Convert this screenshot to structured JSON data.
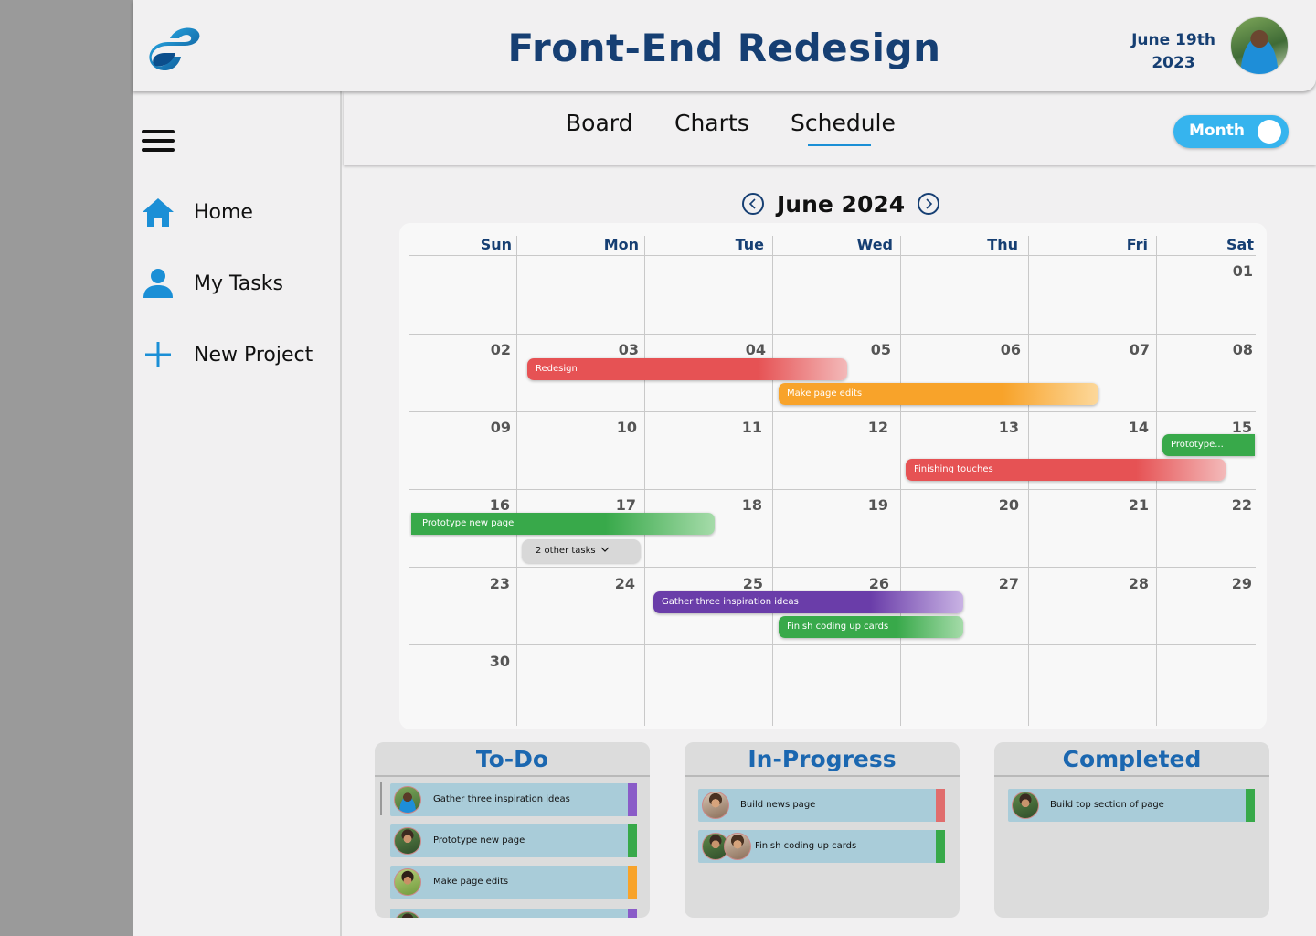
{
  "header": {
    "title": "Front-End Redesign",
    "date_line1": "June 19th",
    "date_line2": "2023"
  },
  "sidebar": {
    "items": [
      {
        "label": "Home",
        "icon": "home-icon"
      },
      {
        "label": "My Tasks",
        "icon": "user-icon"
      },
      {
        "label": "New Project",
        "icon": "plus-icon"
      }
    ]
  },
  "tabs": [
    {
      "label": "Board"
    },
    {
      "label": "Charts"
    },
    {
      "label": "Schedule",
      "active": true
    }
  ],
  "view_toggle": {
    "label": "Month",
    "on": true
  },
  "calendar": {
    "month_label": "June 2024",
    "weekdays": [
      "Sun",
      "Mon",
      "Tue",
      "Wed",
      "Thu",
      "Fri",
      "Sat"
    ],
    "days": [
      "01",
      "02",
      "03",
      "04",
      "05",
      "06",
      "07",
      "08",
      "09",
      "10",
      "11",
      "12",
      "13",
      "14",
      "15",
      "16",
      "17",
      "18",
      "19",
      "20",
      "21",
      "22",
      "23",
      "24",
      "25",
      "26",
      "27",
      "28",
      "29",
      "30"
    ],
    "events": [
      {
        "title": "Redesign",
        "color": "#e65254"
      },
      {
        "title": "Make page edits",
        "color": "#f8a32a"
      },
      {
        "title": "Prototype...",
        "color": "#38a94a"
      },
      {
        "title": "Finishing touches",
        "color": "#e65254"
      },
      {
        "title": "Prototype new page",
        "color": "#38a94a"
      },
      {
        "title": "Gather three inspiration ideas",
        "color": "#6a3da9"
      },
      {
        "title": "Finish coding up cards",
        "color": "#38a94a"
      }
    ],
    "more_tasks": "2 other tasks"
  },
  "kanban": {
    "todo": {
      "title": "To-Do",
      "cards": [
        {
          "title": "Gather three inspiration ideas",
          "color": "#8a5cc8"
        },
        {
          "title": "Prototype new page",
          "color": "#38a94a"
        },
        {
          "title": "Make page edits",
          "color": "#f8a32a"
        }
      ]
    },
    "inprogress": {
      "title": "In-Progress",
      "cards": [
        {
          "title": "Build news page",
          "color": "#e06d6d"
        },
        {
          "title": "Finish coding up cards",
          "color": "#38a94a"
        }
      ]
    },
    "completed": {
      "title": "Completed",
      "cards": [
        {
          "title": "Build top section of page",
          "color": "#38a94a"
        }
      ]
    }
  },
  "colors": {
    "primary": "#163f73",
    "accent": "#1b8fd6",
    "toggle": "#36b4ee"
  }
}
